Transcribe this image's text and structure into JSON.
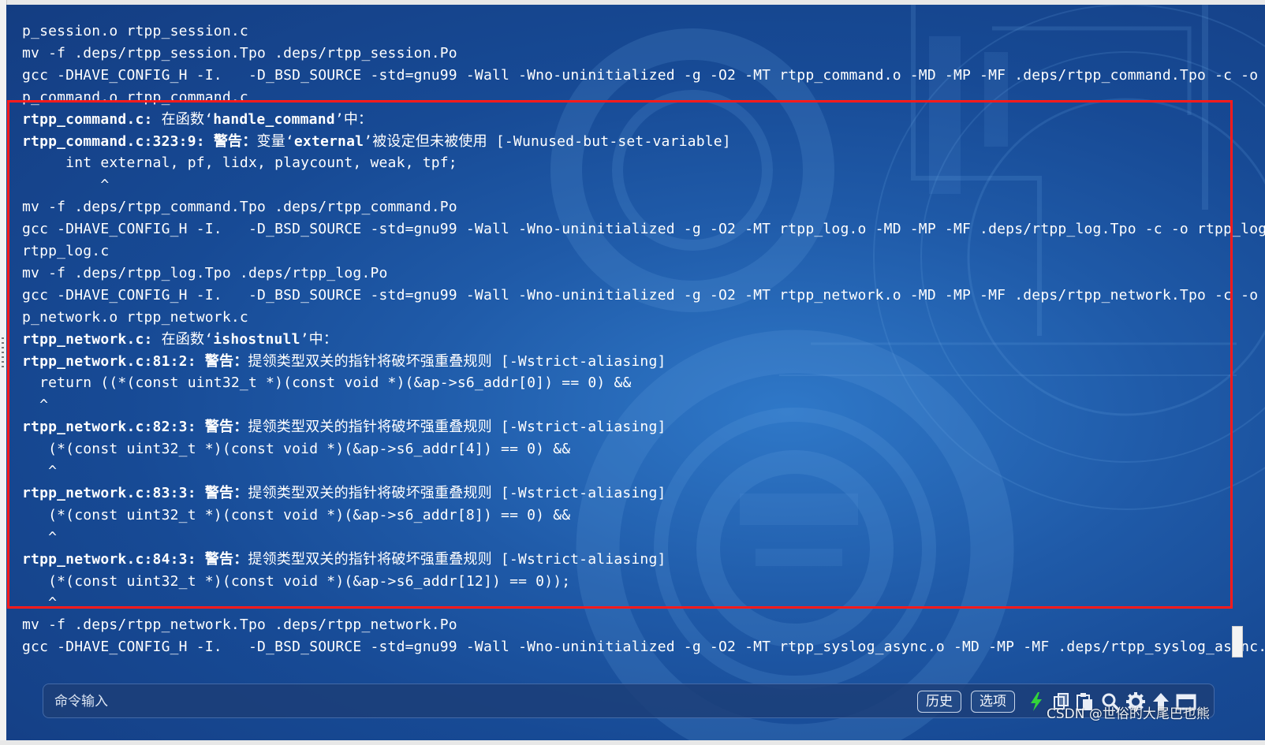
{
  "terminal": {
    "lines": [
      {
        "segments": [
          {
            "text": "p_session.o rtpp_session.c",
            "bold": false
          }
        ]
      },
      {
        "segments": [
          {
            "text": "mv -f .deps/rtpp_session.Tpo .deps/rtpp_session.Po",
            "bold": false
          }
        ]
      },
      {
        "segments": [
          {
            "text": "gcc -DHAVE_CONFIG_H -I.   -D_BSD_SOURCE -std=gnu99 -Wall -Wno-uninitialized -g -O2 -MT rtpp_command.o -MD -MP -MF .deps/rtpp_command.Tpo -c -o rtp",
            "bold": false
          }
        ]
      },
      {
        "segments": [
          {
            "text": "p_command.o rtpp_command.c",
            "bold": false
          }
        ]
      },
      {
        "segments": [
          {
            "text": "rtpp_command.c:",
            "bold": true
          },
          {
            "text": " 在函数‘",
            "bold": false
          },
          {
            "text": "handle_command",
            "bold": true
          },
          {
            "text": "’中：",
            "bold": false
          }
        ]
      },
      {
        "segments": [
          {
            "text": "rtpp_command.c:323:9:",
            "bold": true
          },
          {
            "text": " ",
            "bold": false
          },
          {
            "text": "警告：",
            "bold": true
          },
          {
            "text": "变量‘",
            "bold": false
          },
          {
            "text": "external",
            "bold": true
          },
          {
            "text": "’被设定但未被使用 [-Wunused-but-set-variable]",
            "bold": false
          }
        ]
      },
      {
        "segments": [
          {
            "text": "     int external, pf, lidx, playcount, weak, tpf;",
            "bold": false
          }
        ]
      },
      {
        "segments": [
          {
            "text": "         ^",
            "bold": false
          }
        ]
      },
      {
        "segments": [
          {
            "text": "mv -f .deps/rtpp_command.Tpo .deps/rtpp_command.Po",
            "bold": false
          }
        ]
      },
      {
        "segments": [
          {
            "text": "gcc -DHAVE_CONFIG_H -I.   -D_BSD_SOURCE -std=gnu99 -Wall -Wno-uninitialized -g -O2 -MT rtpp_log.o -MD -MP -MF .deps/rtpp_log.Tpo -c -o rtpp_log.o",
            "bold": false
          }
        ]
      },
      {
        "segments": [
          {
            "text": "rtpp_log.c",
            "bold": false
          }
        ]
      },
      {
        "segments": [
          {
            "text": "mv -f .deps/rtpp_log.Tpo .deps/rtpp_log.Po",
            "bold": false
          }
        ]
      },
      {
        "segments": [
          {
            "text": "gcc -DHAVE_CONFIG_H -I.   -D_BSD_SOURCE -std=gnu99 -Wall -Wno-uninitialized -g -O2 -MT rtpp_network.o -MD -MP -MF .deps/rtpp_network.Tpo -c -o rtp",
            "bold": false
          }
        ]
      },
      {
        "segments": [
          {
            "text": "p_network.o rtpp_network.c",
            "bold": false
          }
        ]
      },
      {
        "segments": [
          {
            "text": "rtpp_network.c:",
            "bold": true
          },
          {
            "text": " 在函数‘",
            "bold": false
          },
          {
            "text": "ishostnull",
            "bold": true
          },
          {
            "text": "’中：",
            "bold": false
          }
        ]
      },
      {
        "segments": [
          {
            "text": "rtpp_network.c:81:2:",
            "bold": true
          },
          {
            "text": " ",
            "bold": false
          },
          {
            "text": "警告：",
            "bold": true
          },
          {
            "text": "提领类型双关的指针将破坏强重叠规则 [-Wstrict-aliasing]",
            "bold": false
          }
        ]
      },
      {
        "segments": [
          {
            "text": "  return ((*(const uint32_t *)(const void *)(&ap->s6_addr[0]) == 0) &&",
            "bold": false
          }
        ]
      },
      {
        "segments": [
          {
            "text": "  ^",
            "bold": false
          }
        ]
      },
      {
        "segments": [
          {
            "text": "rtpp_network.c:82:3:",
            "bold": true
          },
          {
            "text": " ",
            "bold": false
          },
          {
            "text": "警告：",
            "bold": true
          },
          {
            "text": "提领类型双关的指针将破坏强重叠规则 [-Wstrict-aliasing]",
            "bold": false
          }
        ]
      },
      {
        "segments": [
          {
            "text": "   (*(const uint32_t *)(const void *)(&ap->s6_addr[4]) == 0) &&",
            "bold": false
          }
        ]
      },
      {
        "segments": [
          {
            "text": "   ^",
            "bold": false
          }
        ]
      },
      {
        "segments": [
          {
            "text": "rtpp_network.c:83:3:",
            "bold": true
          },
          {
            "text": " ",
            "bold": false
          },
          {
            "text": "警告：",
            "bold": true
          },
          {
            "text": "提领类型双关的指针将破坏强重叠规则 [-Wstrict-aliasing]",
            "bold": false
          }
        ]
      },
      {
        "segments": [
          {
            "text": "   (*(const uint32_t *)(const void *)(&ap->s6_addr[8]) == 0) &&",
            "bold": false
          }
        ]
      },
      {
        "segments": [
          {
            "text": "   ^",
            "bold": false
          }
        ]
      },
      {
        "segments": [
          {
            "text": "rtpp_network.c:84:3:",
            "bold": true
          },
          {
            "text": " ",
            "bold": false
          },
          {
            "text": "警告：",
            "bold": true
          },
          {
            "text": "提领类型双关的指针将破坏强重叠规则 [-Wstrict-aliasing]",
            "bold": false
          }
        ]
      },
      {
        "segments": [
          {
            "text": "   (*(const uint32_t *)(const void *)(&ap->s6_addr[12]) == 0));",
            "bold": false
          }
        ]
      },
      {
        "segments": [
          {
            "text": "   ^",
            "bold": false
          }
        ]
      },
      {
        "segments": [
          {
            "text": "mv -f .deps/rtpp_network.Tpo .deps/rtpp_network.Po",
            "bold": false
          }
        ]
      },
      {
        "segments": [
          {
            "text": "gcc -DHAVE_CONFIG_H -I.   -D_BSD_SOURCE -std=gnu99 -Wall -Wno-uninitialized -g -O2 -MT rtpp_syslog_async.o -MD -MP -MF .deps/rtpp_syslog_async.Tpo",
            "bold": false
          }
        ]
      }
    ]
  },
  "command_bar": {
    "placeholder": "命令输入",
    "history_button": "历史",
    "options_button": "选项",
    "icons": [
      "lightning-icon",
      "copy-icon",
      "paste-icon",
      "search-icon",
      "gear-icon",
      "arrow-up-icon",
      "window-icon"
    ]
  },
  "watermark": "CSDN @世俗的大尾巴也熊",
  "colors": {
    "terminal_text": "#ffffff",
    "highlight_border": "#ff1b1b",
    "lightning": "#33d43a"
  }
}
